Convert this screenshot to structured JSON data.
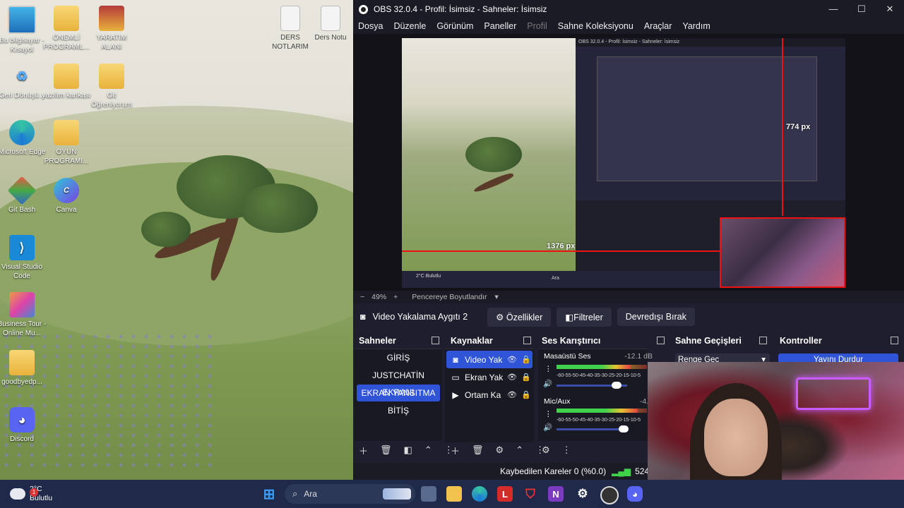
{
  "desktop": {
    "icons": [
      {
        "label": "Bu bilgisayar - Kısayol",
        "kind": "monitor"
      },
      {
        "label": "ÖNEMLİ PROGRAML...",
        "kind": "folder"
      },
      {
        "label": "YARATIM ALANI",
        "kind": "folder"
      },
      {
        "label": "Geri Dönüşü...",
        "kind": "recycle"
      },
      {
        "label": "yazılım kankası",
        "kind": "folder"
      },
      {
        "label": "Git Öğreniyorum",
        "kind": "folder"
      },
      {
        "label": "Microsoft Edge",
        "kind": "edge"
      },
      {
        "label": "OYUN PROGRAMI...",
        "kind": "folder"
      },
      {
        "label": "Git Bash",
        "kind": "git"
      },
      {
        "label": "Canva",
        "kind": "canva"
      },
      {
        "label": "Visual Studio Code",
        "kind": "vscode"
      },
      {
        "label": "Business Tour - Online Mu...",
        "kind": "game"
      },
      {
        "label": "goodbyedp...",
        "kind": "folder"
      },
      {
        "label": "Discord",
        "kind": "discord"
      },
      {
        "label": "DERS NOTLARIM",
        "kind": "document"
      },
      {
        "label": "Ders Notu",
        "kind": "document"
      }
    ]
  },
  "obs": {
    "title": "OBS 32.0.4 - Profil: İsimsiz - Sahneler: İsimsiz",
    "window_controls": [
      "—",
      "☐",
      "✕"
    ],
    "menu": [
      "Dosya",
      "Düzenle",
      "Görünüm",
      "Paneller",
      "Profil",
      "Sahne Koleksiyonu",
      "Araçlar",
      "Yardım"
    ],
    "preview": {
      "measure_horizontal": "1376 px",
      "measure_vertical": "774 px",
      "nested_title": "OBS 32.0.4 - Profil: İsimsiz - Sahneler: İsimsiz",
      "nested_taskbar_weather": "2°C Bulutlu",
      "nested_search": "Ara"
    },
    "zoom": {
      "minus": "−",
      "value": "49%",
      "plus": "+",
      "mode": "Pencereye Boyutlandır"
    },
    "source_toolbar": {
      "source_name": "Video Yakalama Aygıtı 2",
      "properties": "Özellikler",
      "filters": "Filtreler",
      "deactivate": "Devredışı Bırak"
    },
    "docks": {
      "scenes_title": "Sahneler",
      "sources_title": "Kaynaklar",
      "mixer_title": "Ses Karıştırıcı",
      "transitions_title": "Sahne Geçişleri",
      "controls_title": "Kontroller"
    },
    "scenes": [
      {
        "name": "GİRİŞ",
        "active": false
      },
      {
        "name": "JUSTCHATİN EKRANI",
        "active": false
      },
      {
        "name": "EKRAN YANSITMA",
        "active": true
      },
      {
        "name": "BİTİŞ",
        "active": false
      }
    ],
    "sources": [
      {
        "name": "Video Yak",
        "icon": "camera",
        "active": true
      },
      {
        "name": "Ekran Yak",
        "icon": "monitor",
        "active": false
      },
      {
        "name": "Ortam Ka",
        "icon": "play",
        "active": false
      }
    ],
    "mixer": [
      {
        "name": "Masaüstü Ses",
        "db": "-12.1 dB",
        "level": 0.82,
        "volume": 0.85
      },
      {
        "name": "Mic/Aux",
        "db": "-4.7",
        "level": 0.9,
        "volume": 0.95
      }
    ],
    "meter_ticks": "-60-55-50-45-40-35-30-25-20-15-10-5",
    "transition": "Renge Geç",
    "controls_stream": "Yayını Durdur",
    "status": {
      "dropped": "Kaybedilen Kareler 0 (%0.0)",
      "bitrate": "5240 k"
    }
  },
  "taskbar": {
    "weather_temp": "2°C",
    "weather_text": "Bulutlu",
    "weather_badge": "1",
    "search_placeholder": "Ara"
  }
}
